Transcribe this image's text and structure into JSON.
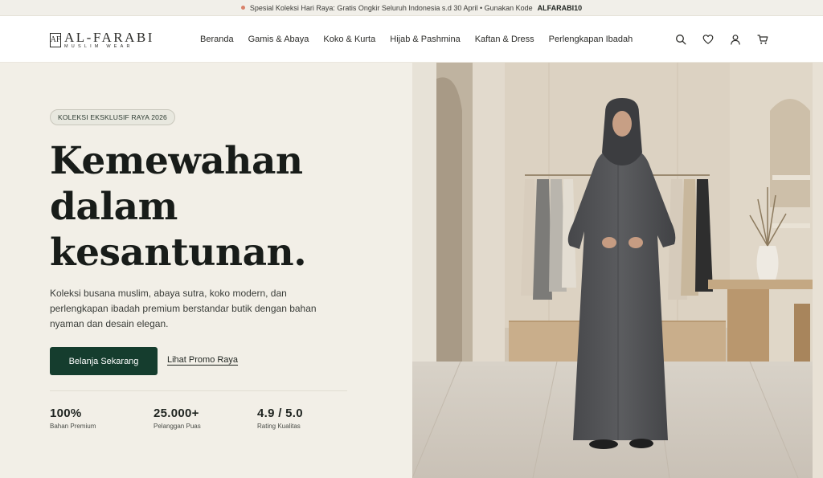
{
  "announcement": {
    "text": "Spesial Koleksi Hari Raya: Gratis Ongkir Seluruh Indonesia s.d 30 April • Gunakan Kode",
    "code": "ALFARABI10",
    "dot_color": "#d9826a"
  },
  "header": {
    "logo_mark": "AF",
    "logo_name": "AL-FARABI",
    "logo_sub": "MUSLIM WEAR",
    "nav": [
      "Beranda",
      "Gamis & Abaya",
      "Koko & Kurta",
      "Hijab & Pashmina",
      "Kaftan & Dress",
      "Perlengkapan Ibadah"
    ],
    "icons": [
      "search-icon",
      "heart-icon",
      "user-icon",
      "cart-icon"
    ]
  },
  "hero": {
    "badge": "KOLEKSI EKSKLUSIF RAYA 2026",
    "headline": [
      "Kemewahan",
      "dalam",
      "kesantunan."
    ],
    "description": "Koleksi busana muslim, abaya sutra, koko modern, dan perlengkapan ibadah premium berstandar butik dengan bahan nyaman dan desain elegan.",
    "primary_button": "Belanja Sekarang",
    "secondary_link": "Lihat Promo Raya",
    "stats": [
      {
        "value": "100%",
        "label": "Bahan Premium"
      },
      {
        "value": "25.000+",
        "label": "Pelanggan Puas"
      },
      {
        "value": "4.9 / 5.0",
        "label": "Rating Kualitas"
      }
    ]
  },
  "colors": {
    "accent": "#153d2e",
    "background": "#f2efe7"
  }
}
